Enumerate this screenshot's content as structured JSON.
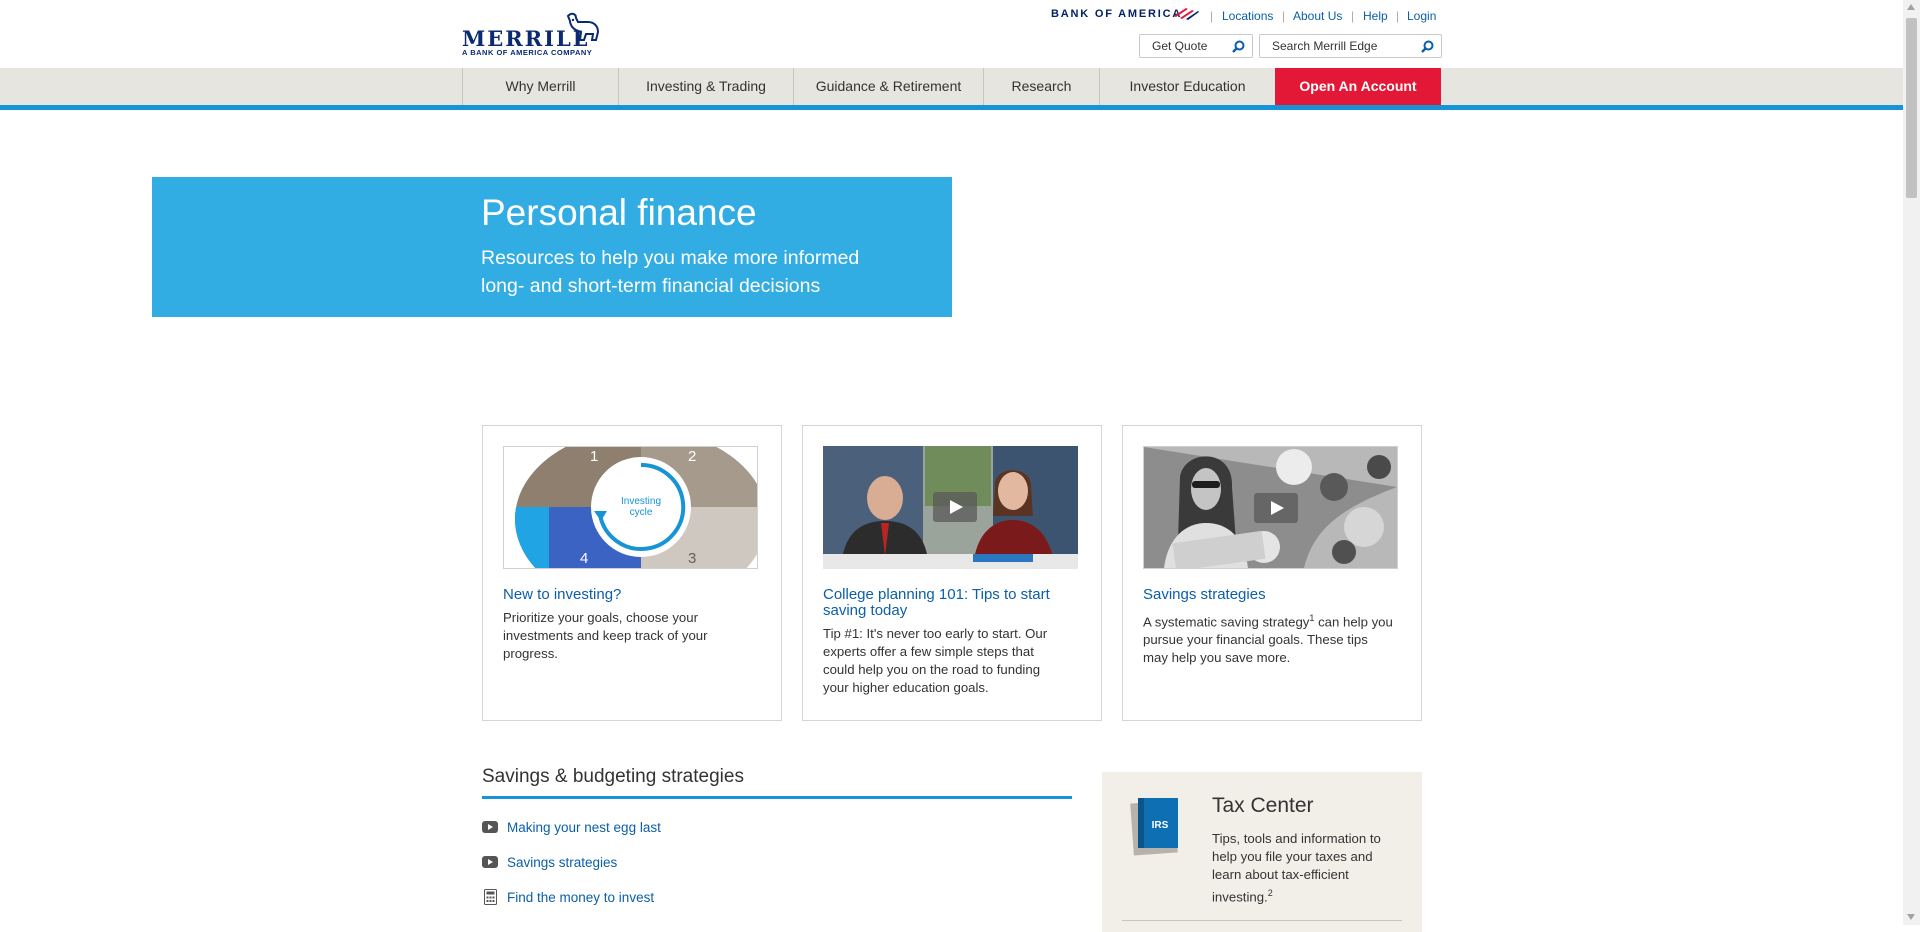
{
  "header": {
    "logo_text": "MERRILL",
    "logo_sub": "A BANK OF AMERICA COMPANY",
    "partner_logo_text": "BANK OF AMERICA",
    "links": [
      "Locations",
      "About Us",
      "Help",
      "Login"
    ],
    "quote_search": {
      "placeholder": "Get Quote"
    },
    "site_search": {
      "placeholder": "Search Merrill Edge"
    }
  },
  "nav": {
    "items": [
      "Why Merrill",
      "Investing & Trading",
      "Guidance & Retirement",
      "Research",
      "Investor Education"
    ],
    "cta": "Open An Account"
  },
  "hero": {
    "title": "Personal finance",
    "subtitle": "Resources to help you make more informed long- and short-term financial decisions"
  },
  "cards": [
    {
      "title": "New to investing?",
      "text": "Prioritize your goals, choose your investments and keep track of your progress.",
      "image": {
        "type": "investing-cycle-diagram",
        "center_label_line1": "Investing",
        "center_label_line2": "cycle",
        "quadrants": [
          "1",
          "2",
          "3",
          "4"
        ]
      }
    },
    {
      "title": "College planning 101: Tips to start saving today",
      "text": "Tip #1: It's never too early to start. Our experts offer a few simple steps that could help you on the road to funding your higher education goals.",
      "image": {
        "type": "video-thumbnail"
      }
    },
    {
      "title": "Savings strategies",
      "text_before": "A systematic saving strategy",
      "footnote": "1",
      "text_after": " can help you pursue your financial goals. These tips may help you save more.",
      "image": {
        "type": "video-thumbnail"
      }
    }
  ],
  "savings_section": {
    "title": "Savings & budgeting strategies",
    "links": [
      {
        "label": "Making your nest egg last",
        "icon": "video-icon"
      },
      {
        "label": "Savings strategies",
        "icon": "video-icon"
      },
      {
        "label": "Find the money to invest",
        "icon": "calculator-icon"
      }
    ]
  },
  "tax_center": {
    "title": "Tax Center",
    "text": "Tips, tools and information to help you file your taxes and learn about tax-efficient investing.",
    "footnote": "2",
    "badge": "IRS"
  },
  "colors": {
    "brand_blue": "#0a2a72",
    "accent_blue": "#31ade4",
    "nav_rule": "#1694d6",
    "cta_red": "#e31837",
    "link": "#0b5fa8"
  }
}
